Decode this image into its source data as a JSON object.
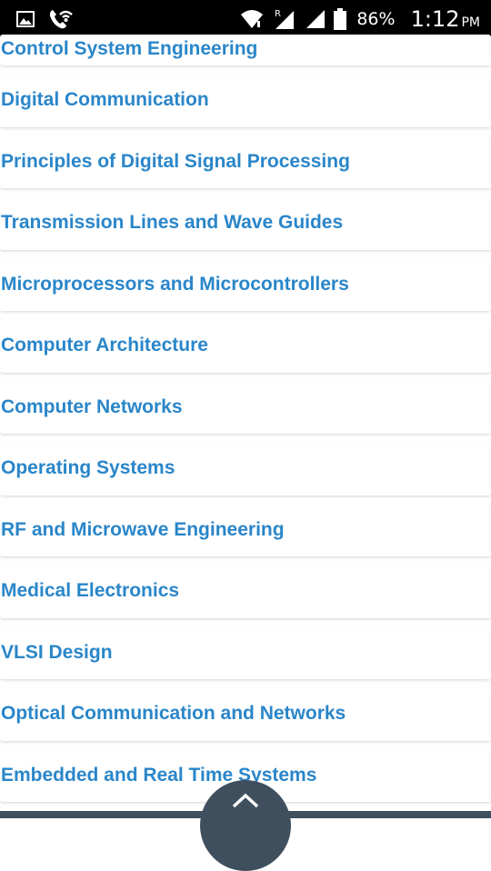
{
  "status_bar": {
    "icons": [
      "image-icon",
      "call-wifi-icon",
      "wifi-icon",
      "roaming-signal-icon",
      "signal-icon",
      "battery-icon"
    ],
    "battery_percent": "86%",
    "time": "1:12",
    "ampm": "PM"
  },
  "list": {
    "items": [
      "Control System Engineering",
      "Digital Communication",
      "Principles of Digital Signal Processing",
      "Transmission Lines and Wave Guides",
      "Microprocessors and Microcontrollers",
      "Computer Architecture",
      "Computer Networks",
      "Operating Systems",
      "RF and Microwave Engineering",
      "Medical Electronics",
      "VLSI Design",
      "Optical Communication and Networks",
      "Embedded and Real Time Systems"
    ]
  },
  "colors": {
    "link": "#2a86c9",
    "status_bar": "#000000",
    "bottom_bar": "#3f4f5d"
  }
}
